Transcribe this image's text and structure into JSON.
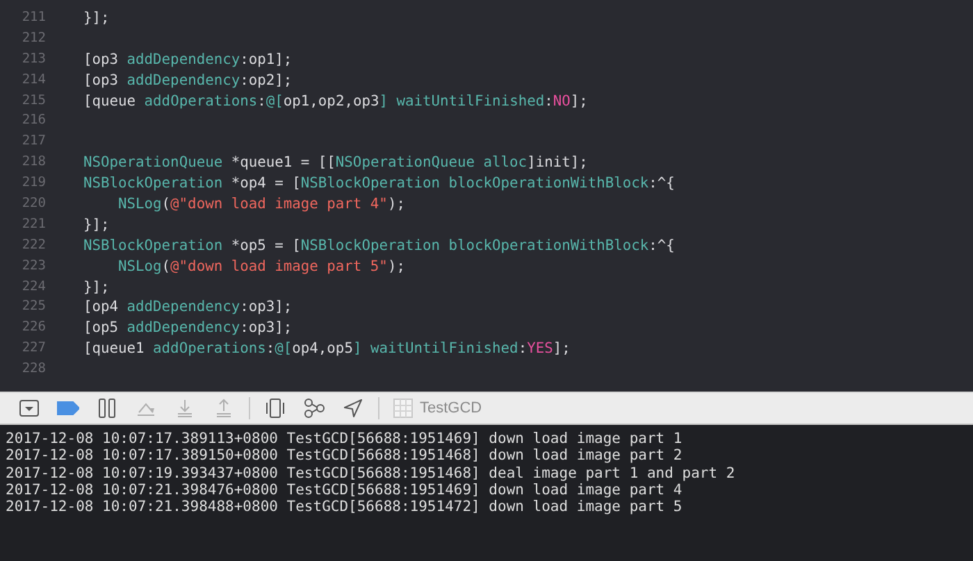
{
  "editor": {
    "lines": [
      {
        "number": "211",
        "tokens": [
          {
            "kind": "plain",
            "text": "}];"
          }
        ]
      },
      {
        "number": "212"
      },
      {
        "number": "213",
        "tokens": [
          {
            "kind": "plain",
            "text": "[op3 "
          },
          {
            "kind": "method",
            "text": "addDependency"
          },
          {
            "kind": "plain",
            "text": ":op1];"
          }
        ]
      },
      {
        "number": "214",
        "tokens": [
          {
            "kind": "plain",
            "text": "[op3 "
          },
          {
            "kind": "method",
            "text": "addDependency"
          },
          {
            "kind": "plain",
            "text": ":op2];"
          }
        ]
      },
      {
        "number": "215",
        "tokens": [
          {
            "kind": "plain",
            "text": "[queue "
          },
          {
            "kind": "method",
            "text": "addOperations"
          },
          {
            "kind": "plain",
            "text": ":"
          },
          {
            "kind": "method",
            "text": "@["
          },
          {
            "kind": "plain",
            "text": "op1,op2,op3"
          },
          {
            "kind": "method",
            "text": "] waitUntilFinished"
          },
          {
            "kind": "plain",
            "text": ":"
          },
          {
            "kind": "keyword",
            "text": "NO"
          },
          {
            "kind": "plain",
            "text": "];"
          }
        ]
      },
      {
        "number": "216"
      },
      {
        "number": "217"
      },
      {
        "number": "218",
        "tokens": [
          {
            "kind": "type",
            "text": "NSOperationQueue"
          },
          {
            "kind": "plain",
            "text": " *queue1 = [["
          },
          {
            "kind": "type",
            "text": "NSOperationQueue"
          },
          {
            "kind": "method",
            "text": " alloc"
          },
          {
            "kind": "plain",
            "text": "]init];"
          }
        ]
      },
      {
        "number": "219",
        "tokens": [
          {
            "kind": "type",
            "text": "NSBlockOperation"
          },
          {
            "kind": "plain",
            "text": " *op4 = ["
          },
          {
            "kind": "type",
            "text": "NSBlockOperation"
          },
          {
            "kind": "method",
            "text": " blockOperationWithBlock"
          },
          {
            "kind": "plain",
            "text": ":^{"
          }
        ],
        "children": [
          {
            "number": "220",
            "tokens": [
              {
                "kind": "method",
                "text": "NSLog"
              },
              {
                "kind": "plain",
                "text": "("
              },
              {
                "kind": "string",
                "text": "@\"down load image part 4\""
              },
              {
                "kind": "plain",
                "text": ");"
              }
            ]
          }
        ]
      },
      {
        "number": "221",
        "tokens": [
          {
            "kind": "plain",
            "text": "}];"
          }
        ]
      },
      {
        "number": "222",
        "tokens": [
          {
            "kind": "type",
            "text": "NSBlockOperation"
          },
          {
            "kind": "plain",
            "text": " *op5 = ["
          },
          {
            "kind": "type",
            "text": "NSBlockOperation"
          },
          {
            "kind": "method",
            "text": " blockOperationWithBlock"
          },
          {
            "kind": "plain",
            "text": ":^{"
          }
        ],
        "children": [
          {
            "number": "223",
            "tokens": [
              {
                "kind": "method",
                "text": "NSLog"
              },
              {
                "kind": "plain",
                "text": "("
              },
              {
                "kind": "string",
                "text": "@\"down load image part 5\""
              },
              {
                "kind": "plain",
                "text": ");"
              }
            ]
          }
        ]
      },
      {
        "number": "224",
        "tokens": [
          {
            "kind": "plain",
            "text": "}];"
          }
        ]
      },
      {
        "number": "225",
        "tokens": [
          {
            "kind": "plain",
            "text": "[op4 "
          },
          {
            "kind": "method",
            "text": "addDependency"
          },
          {
            "kind": "plain",
            "text": ":op3];"
          }
        ]
      },
      {
        "number": "226",
        "tokens": [
          {
            "kind": "plain",
            "text": "[op5 "
          },
          {
            "kind": "method",
            "text": "addDependency"
          },
          {
            "kind": "plain",
            "text": ":op3];"
          }
        ]
      },
      {
        "number": "227",
        "tokens": [
          {
            "kind": "plain",
            "text": "[queue1 "
          },
          {
            "kind": "method",
            "text": "addOperations"
          },
          {
            "kind": "plain",
            "text": ":"
          },
          {
            "kind": "method",
            "text": "@["
          },
          {
            "kind": "plain",
            "text": "op4,op5"
          },
          {
            "kind": "method",
            "text": "] waitUntilFinished"
          },
          {
            "kind": "plain",
            "text": ":"
          },
          {
            "kind": "keyword",
            "text": "YES"
          },
          {
            "kind": "plain",
            "text": "];"
          }
        ]
      },
      {
        "number": "228"
      }
    ]
  },
  "debug_bar": {
    "breakpoints_active": true,
    "buttons": [
      {
        "kind": "hide-console",
        "disabled": false
      },
      {
        "kind": "breakpoints",
        "disabled": false
      },
      {
        "kind": "pause",
        "disabled": false
      },
      {
        "kind": "step-over",
        "disabled": true
      },
      {
        "kind": "step-into",
        "disabled": true
      },
      {
        "kind": "step-out",
        "disabled": true
      },
      {
        "kind": "view-debugger",
        "disabled": false
      },
      {
        "kind": "memory-graph",
        "disabled": false
      },
      {
        "kind": "location",
        "disabled": false
      }
    ],
    "target": {
      "label": "TestGCD"
    }
  },
  "console": {
    "lines": [
      "2017-12-08 10:07:17.389113+0800 TestGCD[56688:1951469] down load image part 1",
      "2017-12-08 10:07:17.389150+0800 TestGCD[56688:1951468] down load image part 2",
      "2017-12-08 10:07:19.393437+0800 TestGCD[56688:1951468] deal image part 1 and part 2",
      "2017-12-08 10:07:21.398476+0800 TestGCD[56688:1951469] down load image part 4",
      "2017-12-08 10:07:21.398488+0800 TestGCD[56688:1951472] down load image part 5"
    ]
  }
}
